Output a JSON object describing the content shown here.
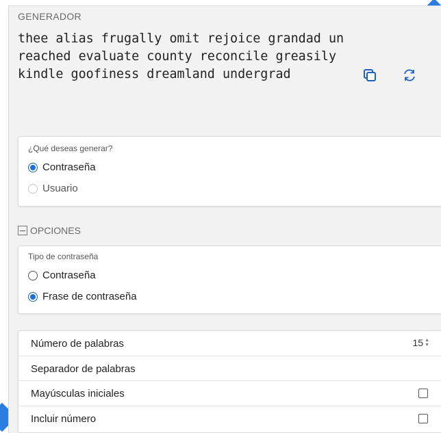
{
  "generator": {
    "title": "GENERADOR",
    "generated_value": "thee alias frugally omit rejoice grandad unreached evaluate county reconcile greasily kindle goofiness dreamland undergrad",
    "copy_icon": "copy-icon",
    "regenerate_icon": "refresh-icon"
  },
  "what_to_generate": {
    "label": "¿Qué deseas generar?",
    "options": [
      {
        "label": "Contraseña",
        "selected": true
      },
      {
        "label": "Usuario",
        "selected": false
      }
    ]
  },
  "options": {
    "header": "OPCIONES",
    "password_type": {
      "label": "Tipo de contraseña",
      "options": [
        {
          "label": "Contraseña",
          "selected": false
        },
        {
          "label": "Frase de contraseña",
          "selected": true
        }
      ]
    },
    "rows": {
      "num_words": {
        "label": "Número de palabras",
        "value": "15"
      },
      "separator": {
        "label": "Separador de palabras",
        "value": ""
      },
      "capitalize": {
        "label": "Mayúsculas iniciales",
        "checked": false
      },
      "include_number": {
        "label": "Incluir número",
        "checked": false
      }
    }
  },
  "colors": {
    "accent": "#1e6fd9",
    "panel_bg": "#f2f2f2",
    "decoration": "#2a7de1"
  }
}
